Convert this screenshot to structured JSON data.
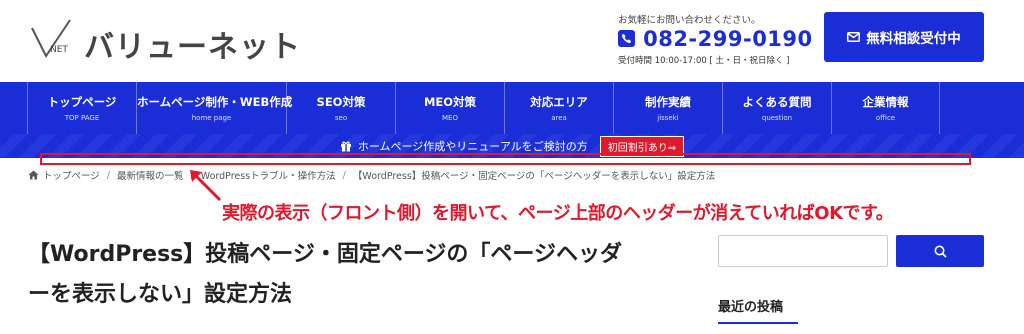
{
  "header": {
    "logo_text": "バリューネット",
    "logo_mark": "NET",
    "contact_note": "お気軽にお問い合わせください。",
    "phone_number": "082-299-0190",
    "hours": "受付時間 10:00-17:00 [ 土・日・祝日除く ]",
    "cta_label": "無料相談受付中"
  },
  "nav": {
    "items": [
      {
        "label": "トップページ",
        "sub": "TOP PAGE"
      },
      {
        "label": "ホームページ制作・WEB作成",
        "sub": "home page"
      },
      {
        "label": "SEO対策",
        "sub": "seo"
      },
      {
        "label": "MEO対策",
        "sub": "MEO"
      },
      {
        "label": "対応エリア",
        "sub": "area"
      },
      {
        "label": "制作実績",
        "sub": "jisseki"
      },
      {
        "label": "よくある質問",
        "sub": "question"
      },
      {
        "label": "企業情報",
        "sub": "office"
      }
    ]
  },
  "promo": {
    "text": "ホームページ作成やリニューアルをご検討の方",
    "badge": "初回割引あり⇒"
  },
  "breadcrumb": {
    "items": [
      "トップページ",
      "最新情報の一覧",
      "WordPressトラブル・操作方法",
      "【WordPress】投稿ページ・固定ページの「ページヘッダーを表示しない」設定方法"
    ]
  },
  "annotation": {
    "text": "実際の表示（フロント側）を開いて、ページ上部のヘッダーが消えていればOKです。"
  },
  "article": {
    "title_line1": "【WordPress】投稿ページ・固定ページの「ページヘッダ",
    "title_line2": "ーを表示しない」設定方法"
  },
  "sidebar": {
    "search_placeholder": "",
    "recent_heading": "最近の投稿"
  },
  "colors": {
    "brand_blue": "#1a2dd6",
    "annotation_red": "#e0192c"
  }
}
